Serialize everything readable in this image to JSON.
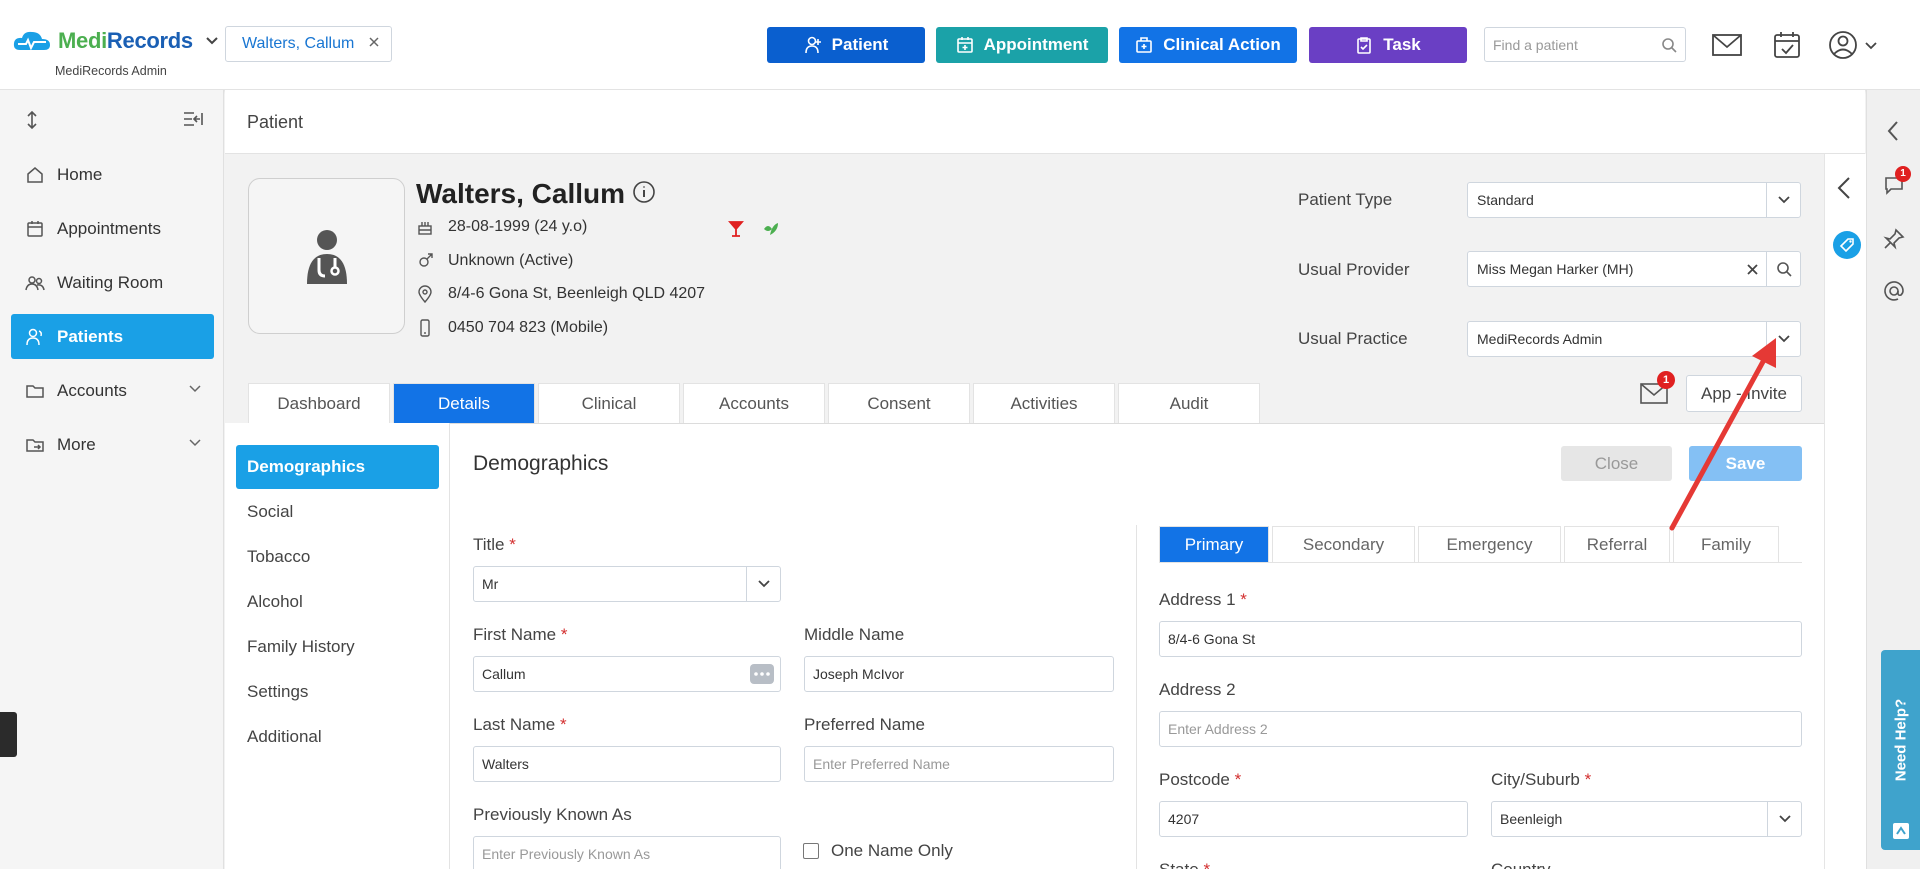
{
  "header": {
    "brand_a": "Medi",
    "brand_b": "Records",
    "brand_sub": "MediRecords Admin",
    "patient_chip": "Walters, Callum",
    "buttons": {
      "patient": "Patient",
      "appointment": "Appointment",
      "clinical_action": "Clinical Action",
      "task": "Task"
    },
    "search_placeholder": "Find a patient"
  },
  "sidebar": {
    "items": [
      {
        "label": "Home",
        "icon": "home-icon"
      },
      {
        "label": "Appointments",
        "icon": "calendar-icon"
      },
      {
        "label": "Waiting Room",
        "icon": "people-icon"
      },
      {
        "label": "Patients",
        "icon": "patients-icon"
      },
      {
        "label": "Accounts",
        "icon": "folder-icon"
      },
      {
        "label": "More",
        "icon": "folder-export-icon"
      }
    ],
    "active": "Patients"
  },
  "page": {
    "title": "Patient"
  },
  "patient": {
    "name": "Walters, Callum",
    "dob": "28-08-1999 (24 y.o)",
    "gender": "Unknown (Active)",
    "address": "8/4-6 Gona St, Beenleigh QLD 4207",
    "phone": "0450 704 823 (Mobile)"
  },
  "patient_fields": {
    "patient_type_label": "Patient Type",
    "patient_type_value": "Standard",
    "usual_provider_label": "Usual Provider",
    "usual_provider_value": "Miss Megan Harker (MH)",
    "usual_practice_label": "Usual Practice",
    "usual_practice_value": "MediRecords Admin"
  },
  "tabs": [
    "Dashboard",
    "Details",
    "Clinical",
    "Accounts",
    "Consent",
    "Activities",
    "Audit"
  ],
  "active_tab": "Details",
  "mail_badge": "1",
  "app_invite": "App - Invite",
  "subnav": [
    "Demographics",
    "Social",
    "Tobacco",
    "Alcohol",
    "Family History",
    "Settings",
    "Additional"
  ],
  "demographics": {
    "title": "Demographics",
    "close": "Close",
    "save": "Save",
    "title_label": "Title",
    "title_value": "Mr",
    "first_name_label": "First Name",
    "first_name_value": "Callum",
    "middle_name_label": "Middle Name",
    "middle_name_value": "Joseph McIvor",
    "last_name_label": "Last Name",
    "last_name_value": "Walters",
    "preferred_name_label": "Preferred Name",
    "preferred_name_placeholder": "Enter Preferred Name",
    "previously_known_label": "Previously Known As",
    "previously_known_placeholder": "Enter Previously Known As",
    "one_name_only": "One Name Only"
  },
  "address": {
    "tabs": [
      "Primary",
      "Secondary",
      "Emergency",
      "Referral",
      "Family"
    ],
    "active_tab": "Primary",
    "address1_label": "Address 1",
    "address1_value": "8/4-6 Gona St",
    "address2_label": "Address 2",
    "address2_placeholder": "Enter Address 2",
    "postcode_label": "Postcode",
    "postcode_value": "4207",
    "city_label": "City/Suburb",
    "city_value": "Beenleigh",
    "state_label": "State",
    "country_label": "Country"
  },
  "right_rail": {
    "notif_badge": "1",
    "help": "Need Help?"
  },
  "colors": {
    "primary": "#1273e6",
    "active_nav": "#1aa0e6",
    "appointment": "#1ba2a8",
    "task": "#6a3fc4",
    "annotation_arrow": "#e53935"
  }
}
